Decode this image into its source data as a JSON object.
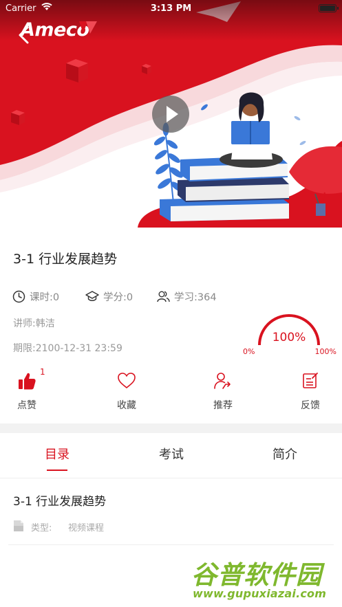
{
  "status_bar": {
    "carrier": "Carrier",
    "time": "3:13 PM"
  },
  "hero": {
    "logo_text": "Ameco",
    "accent_color": "#d9121f"
  },
  "course": {
    "title": "3-1 行业发展趋势",
    "hours": "课时:0",
    "credits": "学分:0",
    "learners": "学习:364",
    "lecturer": "讲师:韩洁",
    "deadline": "期限:2100-12-31 23:59",
    "progress": {
      "value": 1.0,
      "label": "100%",
      "min_label": "0%",
      "max_label": "100%"
    }
  },
  "actions": {
    "like": {
      "label": "点赞",
      "count": "1"
    },
    "favorite": {
      "label": "收藏"
    },
    "recommend": {
      "label": "推荐"
    },
    "feedback": {
      "label": "反馈"
    }
  },
  "tabs": [
    {
      "label": "目录",
      "active": true
    },
    {
      "label": "考试",
      "active": false
    },
    {
      "label": "简介",
      "active": false
    }
  ],
  "catalog": [
    {
      "title": "3-1 行业发展趋势",
      "type_label": "类型:",
      "type_value": "视频课程"
    }
  ],
  "watermark": {
    "main": "谷普软件园",
    "url": "www.gupuxiazai.com"
  }
}
